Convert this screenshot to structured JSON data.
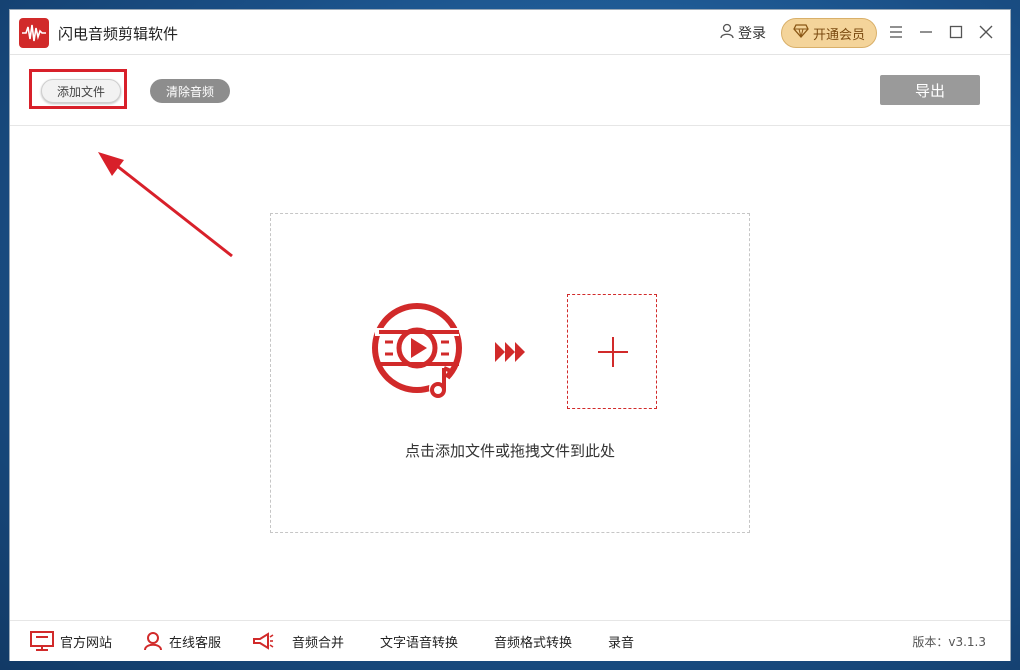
{
  "window": {
    "title": "闪电音频剪辑软件"
  },
  "header": {
    "login_label": "登录",
    "vip_label": "开通会员"
  },
  "toolbar": {
    "add_file_label": "添加文件",
    "clear_label": "清除音频",
    "export_label": "导出"
  },
  "dropzone": {
    "hint": "点击添加文件或拖拽文件到此处"
  },
  "bottom": {
    "items": [
      {
        "label": "官方网站",
        "icon": "monitor-icon"
      },
      {
        "label": "在线客服",
        "icon": "user-icon"
      },
      {
        "label": "音频合并",
        "icon": "megaphone-icon"
      },
      {
        "label": "文字语音转换"
      },
      {
        "label": "音频格式转换"
      },
      {
        "label": "录音"
      }
    ],
    "version": "版本：v3.1.3"
  },
  "colors": {
    "accent": "#d12a2a",
    "highlight": "#d8202a",
    "vip_bg": "#f4d49a",
    "button_gray": "#9a9a9a"
  }
}
